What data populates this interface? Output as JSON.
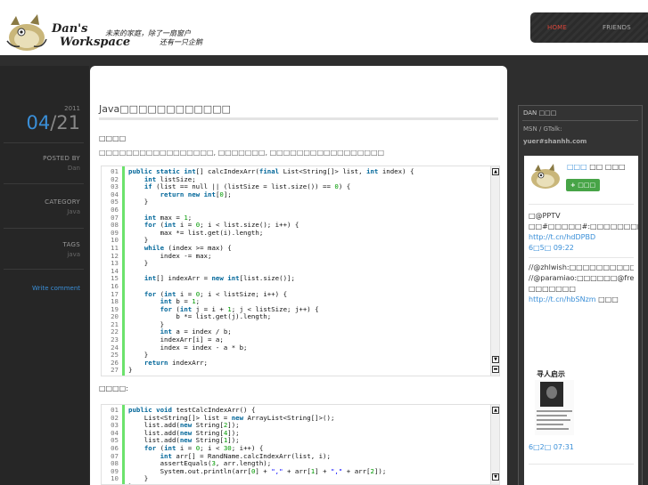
{
  "header": {
    "brand_line1": "Dan's",
    "brand_line2": "Workspace",
    "tagline1": "未来的家庭，除了一扇窗户",
    "tagline2": "还有一只企鹅",
    "nav": [
      {
        "label": "HOME",
        "active": true
      },
      {
        "label": "FRIENDS",
        "active": false
      }
    ]
  },
  "post_meta": {
    "year": "2011",
    "month": "04",
    "day": "21",
    "posted_by_label": "POSTED BY",
    "posted_by": "Dan",
    "category_label": "CATEGORY",
    "category": "Java",
    "tags_label": "TAGS",
    "tags": "java",
    "write_comment": "Write comment"
  },
  "post": {
    "title": "Java□□□□□□□□□□□□",
    "subheading": "□□□□",
    "paragraph": "□□□□□□□□□□□□□□□□□, □□□□□□□, □□□□□□□□□□□□□□□□□",
    "subheading2": "□□□□:",
    "code1": [
      [
        "01",
        "public static int[] calcIndexArr(final List<String[]> list, int index) {"
      ],
      [
        "02",
        "    int listSize;"
      ],
      [
        "03",
        "    if (list == null || (listSize = list.size()) == 0) {"
      ],
      [
        "04",
        "        return new int[0];"
      ],
      [
        "05",
        "    }"
      ],
      [
        "06",
        ""
      ],
      [
        "07",
        "    int max = 1;"
      ],
      [
        "08",
        "    for (int i = 0; i < list.size(); i++) {"
      ],
      [
        "09",
        "        max *= list.get(i).length;"
      ],
      [
        "10",
        "    }"
      ],
      [
        "11",
        "    while (index >= max) {"
      ],
      [
        "12",
        "        index -= max;"
      ],
      [
        "13",
        "    }"
      ],
      [
        "14",
        ""
      ],
      [
        "15",
        "    int[] indexArr = new int[list.size()];"
      ],
      [
        "16",
        ""
      ],
      [
        "17",
        "    for (int i = 0; i < listSize; i++) {"
      ],
      [
        "18",
        "        int b = 1;"
      ],
      [
        "19",
        "        for (int j = i + 1; j < listSize; j++) {"
      ],
      [
        "20",
        "            b *= list.get(j).length;"
      ],
      [
        "21",
        "        }"
      ],
      [
        "22",
        "        int a = index / b;"
      ],
      [
        "23",
        "        indexArr[i] = a;"
      ],
      [
        "24",
        "        index = index - a * b;"
      ],
      [
        "25",
        "    }"
      ],
      [
        "26",
        "    return indexArr;"
      ],
      [
        "27",
        "}"
      ]
    ],
    "code2": [
      [
        "01",
        "public void testCalcIndexArr() {"
      ],
      [
        "02",
        "    List<String[]> list = new ArrayList<String[]>();"
      ],
      [
        "03",
        "    list.add(new String[2]);"
      ],
      [
        "04",
        "    list.add(new String[4]);"
      ],
      [
        "05",
        "    list.add(new String[1]);"
      ],
      [
        "06",
        "    for (int i = 0; i < 30; i++) {"
      ],
      [
        "07",
        "        int arr[] = RandName.calcIndexArr(list, i);"
      ],
      [
        "08",
        "        assertEquals(3, arr.length);"
      ],
      [
        "09",
        "        System.out.println(arr[0] + \",\" + arr[1] + \",\" + arr[2]);"
      ],
      [
        "10",
        "    }"
      ],
      [
        "11",
        "}"
      ]
    ]
  },
  "sidebar": {
    "head": "DAN □□□",
    "msn": "MSN / GTalk:",
    "email": "yuer#shanhh.com",
    "profile_name_link": "□□□",
    "profile_name_rest": " □□ □□□",
    "follow_label": "+ □□□",
    "tweets": [
      {
        "text": "□@PPTV □□#□□□□□#:□□□□□□□□□□□□□□□□□□□ ",
        "link": "http://t.cn/hdDPBD",
        "time": "6□5□ 09:22"
      },
      {
        "text": "//@zhlwish:□□□□□□□□□□□□□□□□□□□ //@paramiao:□□□□□□@freethen□□□HoodleMobile:□IT□□□□□□□□□□□□□□□Linux□□□□□□□□□□□(stardict)□□iphone□□□□□□□□□□□□□□□□□□□□□□□□□□□□□□□□□□□□□□□□□□□□□□□□GNU□□□□ □□□□□□□ ",
        "link": "http://t.cn/hbSNzm",
        "time_prefix": " □□□"
      },
      {
        "poster_title": "寻人启示",
        "time": "6□2□ 07:31"
      }
    ]
  }
}
